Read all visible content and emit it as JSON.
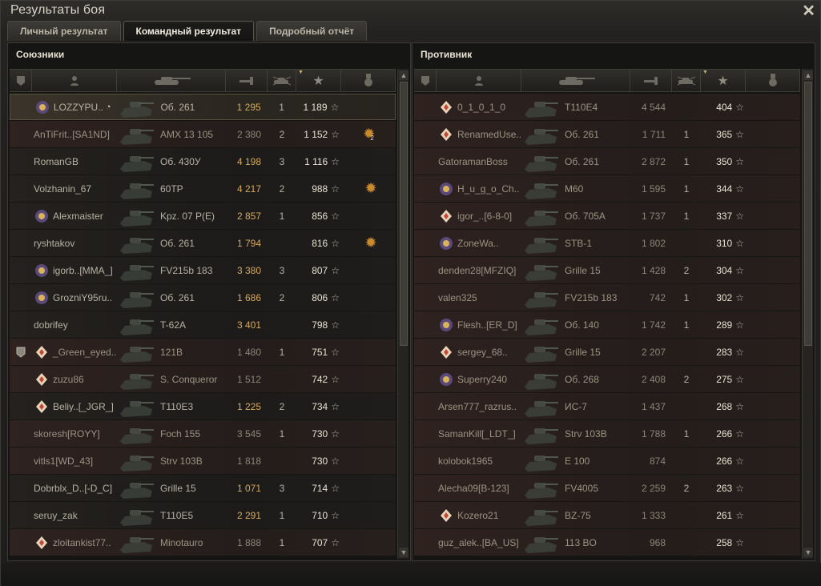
{
  "window": {
    "title": "Результаты боя"
  },
  "tabs": [
    {
      "label": "Личный результат",
      "active": false
    },
    {
      "label": "Командный результат",
      "active": true
    },
    {
      "label": "Подробный отчёт",
      "active": false
    }
  ],
  "allies": {
    "title": "Союзники",
    "rows": [
      {
        "name": "LOZZYPU..",
        "tank": "Об. 261",
        "damage": "1 295",
        "frags": "1",
        "xp": "1 189",
        "icon": "clan-emblem-icon",
        "status": "me",
        "medal": ""
      },
      {
        "name": "AnTiFrit..[SA1ND]",
        "tank": "AMX 13 105",
        "damage": "2 380",
        "frags": "2",
        "xp": "1 152",
        "icon": "",
        "status": "dead",
        "medal": "2"
      },
      {
        "name": "RomanGB",
        "tank": "Об. 430У",
        "damage": "4 198",
        "frags": "3",
        "xp": "1 116",
        "icon": "",
        "status": "alive",
        "medal": ""
      },
      {
        "name": "Volzhanin_67",
        "tank": "60TP",
        "damage": "4 217",
        "frags": "2",
        "xp": "988",
        "icon": "",
        "status": "alive",
        "medal": "1"
      },
      {
        "name": "Alexmaister",
        "tank": "Kpz. 07 P(E)",
        "damage": "2 857",
        "frags": "1",
        "xp": "856",
        "icon": "clan-emblem-icon",
        "status": "alive",
        "medal": ""
      },
      {
        "name": "ryshtakov",
        "tank": "Об. 261",
        "damage": "1 794",
        "frags": "",
        "xp": "816",
        "icon": "",
        "status": "alive",
        "medal": "1"
      },
      {
        "name": "igorb..[MMA_]",
        "tank": "FV215b 183",
        "damage": "3 380",
        "frags": "3",
        "xp": "807",
        "icon": "clan-emblem-icon",
        "status": "alive",
        "medal": ""
      },
      {
        "name": "GrozniY95ru..",
        "tank": "Об. 261",
        "damage": "1 686",
        "frags": "2",
        "xp": "806",
        "icon": "clan-emblem-icon",
        "status": "alive",
        "medal": ""
      },
      {
        "name": "dobrifey",
        "tank": "T-62A",
        "damage": "3 401",
        "frags": "",
        "xp": "798",
        "icon": "",
        "status": "alive",
        "medal": ""
      },
      {
        "name": "_Green_eyed..",
        "tank": "121B",
        "damage": "1 480",
        "frags": "1",
        "xp": "751",
        "icon": "diamond-icon",
        "status": "dead",
        "medal": "",
        "squad": true
      },
      {
        "name": "zuzu86",
        "tank": "S. Conqueror",
        "damage": "1 512",
        "frags": "",
        "xp": "742",
        "icon": "diamond-icon",
        "status": "dead",
        "medal": ""
      },
      {
        "name": "Beliy..[_JGR_]",
        "tank": "T110E3",
        "damage": "1 225",
        "frags": "2",
        "xp": "734",
        "icon": "diamond-icon",
        "status": "alive",
        "medal": ""
      },
      {
        "name": "skoresh[ROYY]",
        "tank": "Foch 155",
        "damage": "3 545",
        "frags": "1",
        "xp": "730",
        "icon": "",
        "status": "dead",
        "medal": ""
      },
      {
        "name": "vitls1[WD_43]",
        "tank": "Strv 103B",
        "damage": "1 818",
        "frags": "",
        "xp": "730",
        "icon": "",
        "status": "dead",
        "medal": ""
      },
      {
        "name": "Dobrblx_D..[-D_C]",
        "tank": "Grille 15",
        "damage": "1 071",
        "frags": "3",
        "xp": "714",
        "icon": "",
        "status": "alive",
        "medal": ""
      },
      {
        "name": "seruy_zak",
        "tank": "T110E5",
        "damage": "2 291",
        "frags": "1",
        "xp": "710",
        "icon": "",
        "status": "alive",
        "medal": ""
      },
      {
        "name": "zloitankist77..",
        "tank": "Minotauro",
        "damage": "1 888",
        "frags": "1",
        "xp": "707",
        "icon": "diamond-icon",
        "status": "dead",
        "medal": ""
      }
    ]
  },
  "enemies": {
    "title": "Противник",
    "rows": [
      {
        "name": "0_1_0_1_0",
        "tank": "T110E4",
        "damage": "4 544",
        "frags": "",
        "xp": "404",
        "icon": "diamond-icon",
        "status": "dead",
        "medal": ""
      },
      {
        "name": "RenamedUse..",
        "tank": "Об. 261",
        "damage": "1 711",
        "frags": "1",
        "xp": "365",
        "icon": "diamond-icon",
        "status": "dead",
        "medal": ""
      },
      {
        "name": "GatoramanBoss",
        "tank": "Об. 261",
        "damage": "2 872",
        "frags": "1",
        "xp": "350",
        "icon": "",
        "status": "dead",
        "medal": ""
      },
      {
        "name": "H_u_g_o_Ch..",
        "tank": "M60",
        "damage": "1 595",
        "frags": "1",
        "xp": "344",
        "icon": "clan-emblem-icon",
        "status": "dead",
        "medal": ""
      },
      {
        "name": "igor_..[6-8-0]",
        "tank": "Об. 705А",
        "damage": "1 737",
        "frags": "1",
        "xp": "337",
        "icon": "diamond-icon",
        "status": "dead",
        "medal": ""
      },
      {
        "name": "ZoneWa..",
        "tank": "STB-1",
        "damage": "1 802",
        "frags": "",
        "xp": "310",
        "icon": "clan-emblem-icon",
        "status": "dead",
        "medal": ""
      },
      {
        "name": "denden28[MFZIQ]",
        "tank": "Grille 15",
        "damage": "1 428",
        "frags": "2",
        "xp": "304",
        "icon": "",
        "status": "dead",
        "medal": ""
      },
      {
        "name": "valen325",
        "tank": "FV215b 183",
        "damage": "742",
        "frags": "1",
        "xp": "302",
        "icon": "",
        "status": "dead",
        "medal": ""
      },
      {
        "name": "Flesh..[ER_D]",
        "tank": "Об. 140",
        "damage": "1 742",
        "frags": "1",
        "xp": "289",
        "icon": "clan-emblem-icon",
        "status": "dead",
        "medal": ""
      },
      {
        "name": "sergey_68..",
        "tank": "Grille 15",
        "damage": "2 207",
        "frags": "",
        "xp": "283",
        "icon": "diamond-icon",
        "status": "dead",
        "medal": ""
      },
      {
        "name": "Superry240",
        "tank": "Об. 268",
        "damage": "2 408",
        "frags": "2",
        "xp": "275",
        "icon": "clan-emblem-icon",
        "status": "dead",
        "medal": ""
      },
      {
        "name": "Arsen777_razrus..",
        "tank": "ИС-7",
        "damage": "1 437",
        "frags": "",
        "xp": "268",
        "icon": "",
        "status": "dead",
        "medal": ""
      },
      {
        "name": "SamanKill[_LDT_]",
        "tank": "Strv 103B",
        "damage": "1 788",
        "frags": "1",
        "xp": "266",
        "icon": "",
        "status": "dead",
        "medal": ""
      },
      {
        "name": "kolobok1965",
        "tank": "E 100",
        "damage": "874",
        "frags": "",
        "xp": "266",
        "icon": "",
        "status": "dead",
        "medal": ""
      },
      {
        "name": "Alecha09[B-123]",
        "tank": "FV4005",
        "damage": "2 259",
        "frags": "2",
        "xp": "263",
        "icon": "",
        "status": "dead",
        "medal": ""
      },
      {
        "name": "Kozero21",
        "tank": "BZ-75",
        "damage": "1 333",
        "frags": "",
        "xp": "261",
        "icon": "diamond-icon",
        "status": "dead",
        "medal": ""
      },
      {
        "name": "guz_alek..[BA_US]",
        "tank": "113 BO",
        "damage": "968",
        "frags": "",
        "xp": "258",
        "icon": "",
        "status": "dead",
        "medal": ""
      }
    ]
  },
  "columns": [
    "squad-icon",
    "player-icon",
    "tank-icon",
    "damage-icon",
    "frags-icon",
    "xp-star-icon",
    "medal-icon"
  ]
}
